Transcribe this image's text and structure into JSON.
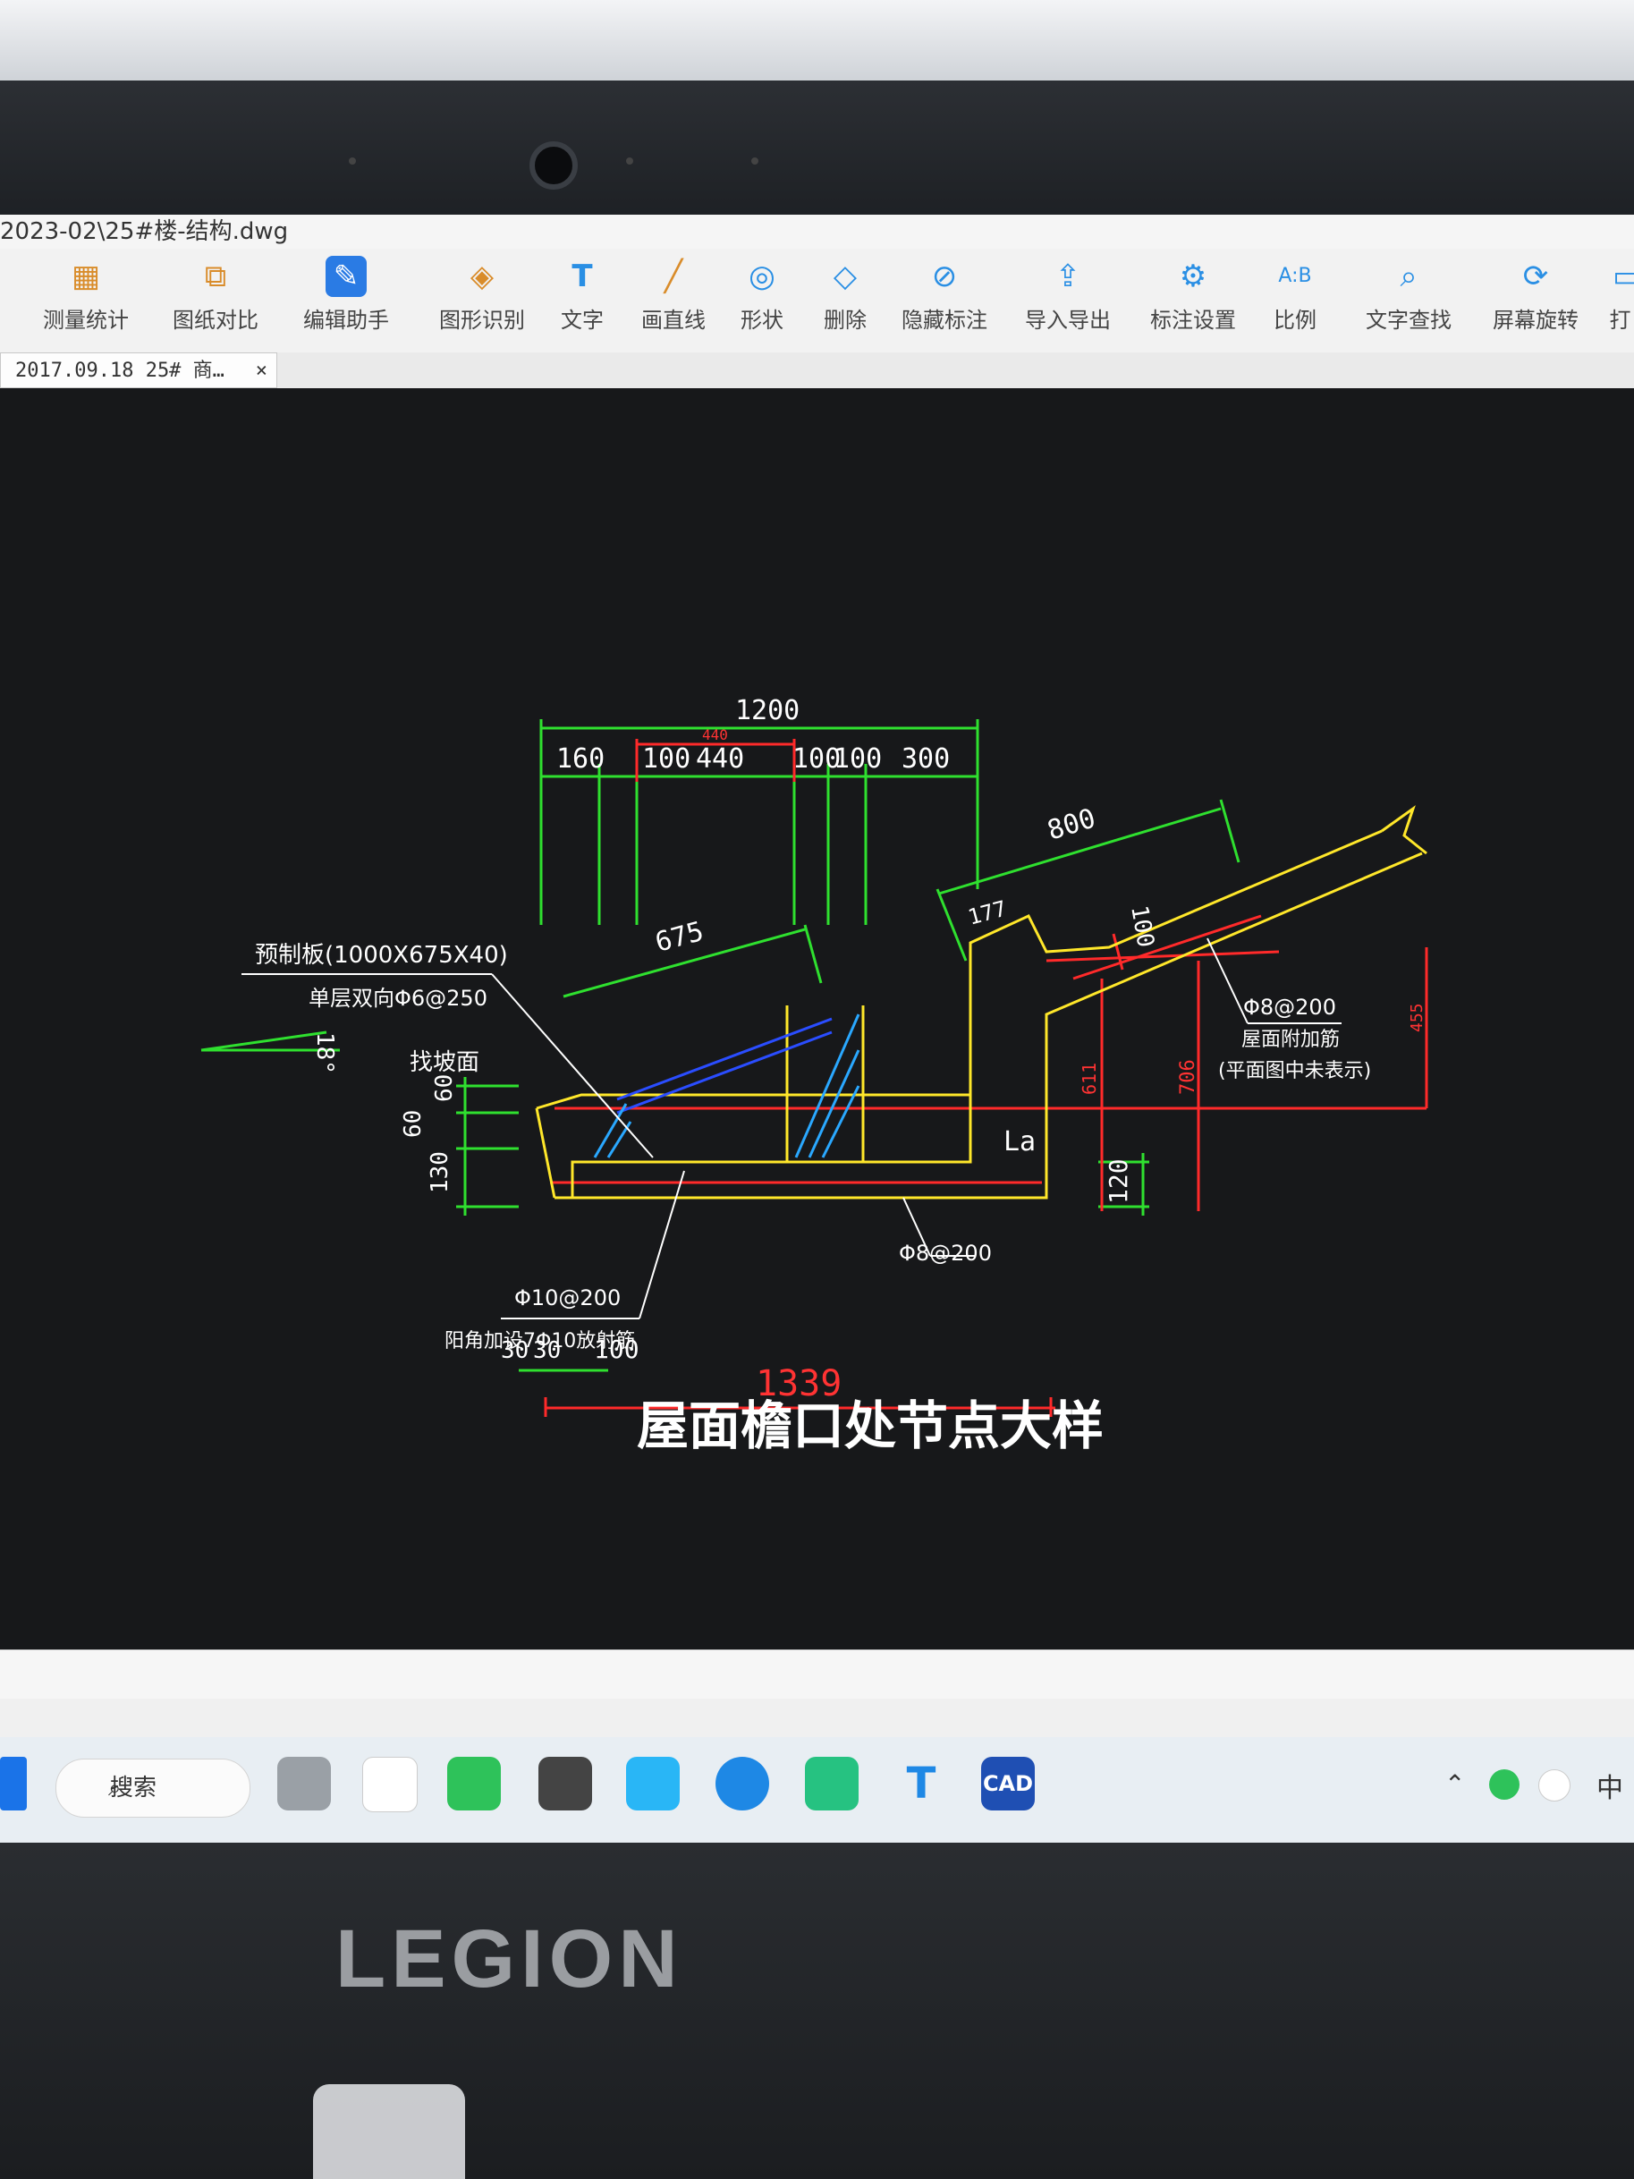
{
  "window": {
    "title": "2023-02\\25#楼-结构.dwg"
  },
  "toolbar": {
    "items": [
      {
        "label": "测量统计",
        "icon": "measure-icon"
      },
      {
        "label": "图纸对比",
        "icon": "compare-icon"
      },
      {
        "label": "编辑助手",
        "icon": "edit-assistant-icon"
      },
      {
        "label": "图形识别",
        "icon": "shape-recognize-icon"
      },
      {
        "label": "文字",
        "icon": "text-icon"
      },
      {
        "label": "画直线",
        "icon": "line-icon"
      },
      {
        "label": "形状",
        "icon": "shape-icon"
      },
      {
        "label": "删除",
        "icon": "eraser-icon"
      },
      {
        "label": "隐藏标注",
        "icon": "hide-annotation-icon"
      },
      {
        "label": "导入导出",
        "icon": "import-export-icon"
      },
      {
        "label": "标注设置",
        "icon": "annotation-settings-icon"
      },
      {
        "label": "比例",
        "icon": "scale-icon"
      },
      {
        "label": "文字查找",
        "icon": "text-search-icon"
      },
      {
        "label": "屏幕旋转",
        "icon": "rotate-screen-icon"
      },
      {
        "label": "打",
        "icon": "print-icon"
      }
    ]
  },
  "tab": {
    "label": "2017.09.18 25# 商…",
    "close": "×"
  },
  "drawing": {
    "title": "屋面檐口处节点大样",
    "dims": {
      "d1200": "1200",
      "d440top": "440",
      "d160": "160",
      "d100a": "100",
      "d440": "440",
      "d100b": "100",
      "d100c": "100",
      "d300": "300",
      "d800": "800",
      "d675": "675",
      "d177": "177",
      "d100d": "100",
      "d611": "611",
      "d706": "706",
      "d455": "455",
      "d120": "120",
      "d1339": "1339",
      "d30a": "30",
      "d30b": "30",
      "d100e": "100",
      "d60a": "60",
      "d60b": "60",
      "d130": "130",
      "angle": "18°",
      "la": "La"
    },
    "notes": {
      "n1": "预制板(1000X675X40)",
      "n2": "单层双向Φ6@250",
      "n3": "找坡面",
      "n4": "Φ8@200",
      "n5": "屋面附加筋",
      "n6": "(平面图中未表示)",
      "n7": "Φ8@200",
      "n8": "Φ10@200",
      "n9": "阳角加设7Φ10放射筋"
    }
  },
  "taskbar": {
    "search": "搜索",
    "cad_label": "CAD",
    "ime": "中"
  },
  "laptop": {
    "brand": "LEGION"
  }
}
